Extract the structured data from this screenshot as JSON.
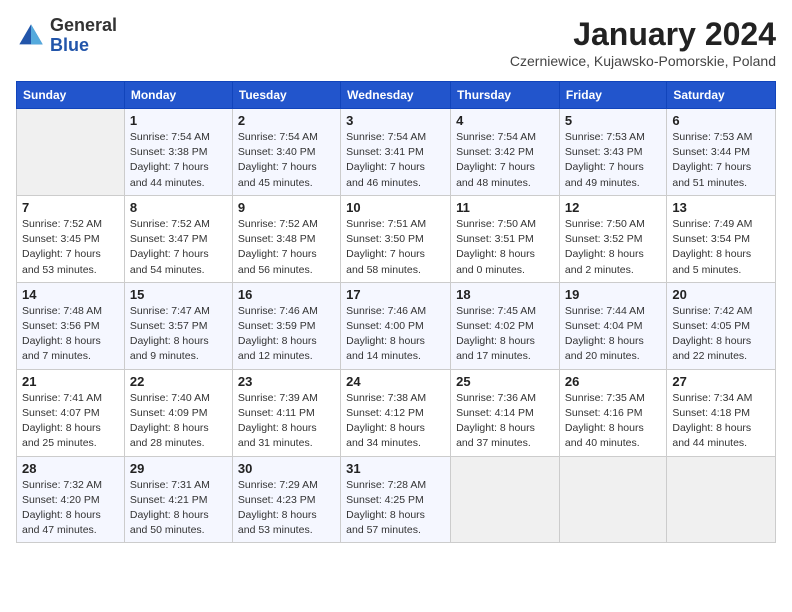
{
  "header": {
    "logo": {
      "text_general": "General",
      "text_blue": "Blue"
    },
    "title": "January 2024",
    "location": "Czerniewice, Kujawsko-Pomorskie, Poland"
  },
  "weekdays": [
    "Sunday",
    "Monday",
    "Tuesday",
    "Wednesday",
    "Thursday",
    "Friday",
    "Saturday"
  ],
  "weeks": [
    [
      {
        "day": "",
        "sunrise": "",
        "sunset": "",
        "daylight": ""
      },
      {
        "day": "1",
        "sunrise": "Sunrise: 7:54 AM",
        "sunset": "Sunset: 3:38 PM",
        "daylight": "Daylight: 7 hours and 44 minutes."
      },
      {
        "day": "2",
        "sunrise": "Sunrise: 7:54 AM",
        "sunset": "Sunset: 3:40 PM",
        "daylight": "Daylight: 7 hours and 45 minutes."
      },
      {
        "day": "3",
        "sunrise": "Sunrise: 7:54 AM",
        "sunset": "Sunset: 3:41 PM",
        "daylight": "Daylight: 7 hours and 46 minutes."
      },
      {
        "day": "4",
        "sunrise": "Sunrise: 7:54 AM",
        "sunset": "Sunset: 3:42 PM",
        "daylight": "Daylight: 7 hours and 48 minutes."
      },
      {
        "day": "5",
        "sunrise": "Sunrise: 7:53 AM",
        "sunset": "Sunset: 3:43 PM",
        "daylight": "Daylight: 7 hours and 49 minutes."
      },
      {
        "day": "6",
        "sunrise": "Sunrise: 7:53 AM",
        "sunset": "Sunset: 3:44 PM",
        "daylight": "Daylight: 7 hours and 51 minutes."
      }
    ],
    [
      {
        "day": "7",
        "sunrise": "Sunrise: 7:52 AM",
        "sunset": "Sunset: 3:45 PM",
        "daylight": "Daylight: 7 hours and 53 minutes."
      },
      {
        "day": "8",
        "sunrise": "Sunrise: 7:52 AM",
        "sunset": "Sunset: 3:47 PM",
        "daylight": "Daylight: 7 hours and 54 minutes."
      },
      {
        "day": "9",
        "sunrise": "Sunrise: 7:52 AM",
        "sunset": "Sunset: 3:48 PM",
        "daylight": "Daylight: 7 hours and 56 minutes."
      },
      {
        "day": "10",
        "sunrise": "Sunrise: 7:51 AM",
        "sunset": "Sunset: 3:50 PM",
        "daylight": "Daylight: 7 hours and 58 minutes."
      },
      {
        "day": "11",
        "sunrise": "Sunrise: 7:50 AM",
        "sunset": "Sunset: 3:51 PM",
        "daylight": "Daylight: 8 hours and 0 minutes."
      },
      {
        "day": "12",
        "sunrise": "Sunrise: 7:50 AM",
        "sunset": "Sunset: 3:52 PM",
        "daylight": "Daylight: 8 hours and 2 minutes."
      },
      {
        "day": "13",
        "sunrise": "Sunrise: 7:49 AM",
        "sunset": "Sunset: 3:54 PM",
        "daylight": "Daylight: 8 hours and 5 minutes."
      }
    ],
    [
      {
        "day": "14",
        "sunrise": "Sunrise: 7:48 AM",
        "sunset": "Sunset: 3:56 PM",
        "daylight": "Daylight: 8 hours and 7 minutes."
      },
      {
        "day": "15",
        "sunrise": "Sunrise: 7:47 AM",
        "sunset": "Sunset: 3:57 PM",
        "daylight": "Daylight: 8 hours and 9 minutes."
      },
      {
        "day": "16",
        "sunrise": "Sunrise: 7:46 AM",
        "sunset": "Sunset: 3:59 PM",
        "daylight": "Daylight: 8 hours and 12 minutes."
      },
      {
        "day": "17",
        "sunrise": "Sunrise: 7:46 AM",
        "sunset": "Sunset: 4:00 PM",
        "daylight": "Daylight: 8 hours and 14 minutes."
      },
      {
        "day": "18",
        "sunrise": "Sunrise: 7:45 AM",
        "sunset": "Sunset: 4:02 PM",
        "daylight": "Daylight: 8 hours and 17 minutes."
      },
      {
        "day": "19",
        "sunrise": "Sunrise: 7:44 AM",
        "sunset": "Sunset: 4:04 PM",
        "daylight": "Daylight: 8 hours and 20 minutes."
      },
      {
        "day": "20",
        "sunrise": "Sunrise: 7:42 AM",
        "sunset": "Sunset: 4:05 PM",
        "daylight": "Daylight: 8 hours and 22 minutes."
      }
    ],
    [
      {
        "day": "21",
        "sunrise": "Sunrise: 7:41 AM",
        "sunset": "Sunset: 4:07 PM",
        "daylight": "Daylight: 8 hours and 25 minutes."
      },
      {
        "day": "22",
        "sunrise": "Sunrise: 7:40 AM",
        "sunset": "Sunset: 4:09 PM",
        "daylight": "Daylight: 8 hours and 28 minutes."
      },
      {
        "day": "23",
        "sunrise": "Sunrise: 7:39 AM",
        "sunset": "Sunset: 4:11 PM",
        "daylight": "Daylight: 8 hours and 31 minutes."
      },
      {
        "day": "24",
        "sunrise": "Sunrise: 7:38 AM",
        "sunset": "Sunset: 4:12 PM",
        "daylight": "Daylight: 8 hours and 34 minutes."
      },
      {
        "day": "25",
        "sunrise": "Sunrise: 7:36 AM",
        "sunset": "Sunset: 4:14 PM",
        "daylight": "Daylight: 8 hours and 37 minutes."
      },
      {
        "day": "26",
        "sunrise": "Sunrise: 7:35 AM",
        "sunset": "Sunset: 4:16 PM",
        "daylight": "Daylight: 8 hours and 40 minutes."
      },
      {
        "day": "27",
        "sunrise": "Sunrise: 7:34 AM",
        "sunset": "Sunset: 4:18 PM",
        "daylight": "Daylight: 8 hours and 44 minutes."
      }
    ],
    [
      {
        "day": "28",
        "sunrise": "Sunrise: 7:32 AM",
        "sunset": "Sunset: 4:20 PM",
        "daylight": "Daylight: 8 hours and 47 minutes."
      },
      {
        "day": "29",
        "sunrise": "Sunrise: 7:31 AM",
        "sunset": "Sunset: 4:21 PM",
        "daylight": "Daylight: 8 hours and 50 minutes."
      },
      {
        "day": "30",
        "sunrise": "Sunrise: 7:29 AM",
        "sunset": "Sunset: 4:23 PM",
        "daylight": "Daylight: 8 hours and 53 minutes."
      },
      {
        "day": "31",
        "sunrise": "Sunrise: 7:28 AM",
        "sunset": "Sunset: 4:25 PM",
        "daylight": "Daylight: 8 hours and 57 minutes."
      },
      {
        "day": "",
        "sunrise": "",
        "sunset": "",
        "daylight": ""
      },
      {
        "day": "",
        "sunrise": "",
        "sunset": "",
        "daylight": ""
      },
      {
        "day": "",
        "sunrise": "",
        "sunset": "",
        "daylight": ""
      }
    ]
  ]
}
